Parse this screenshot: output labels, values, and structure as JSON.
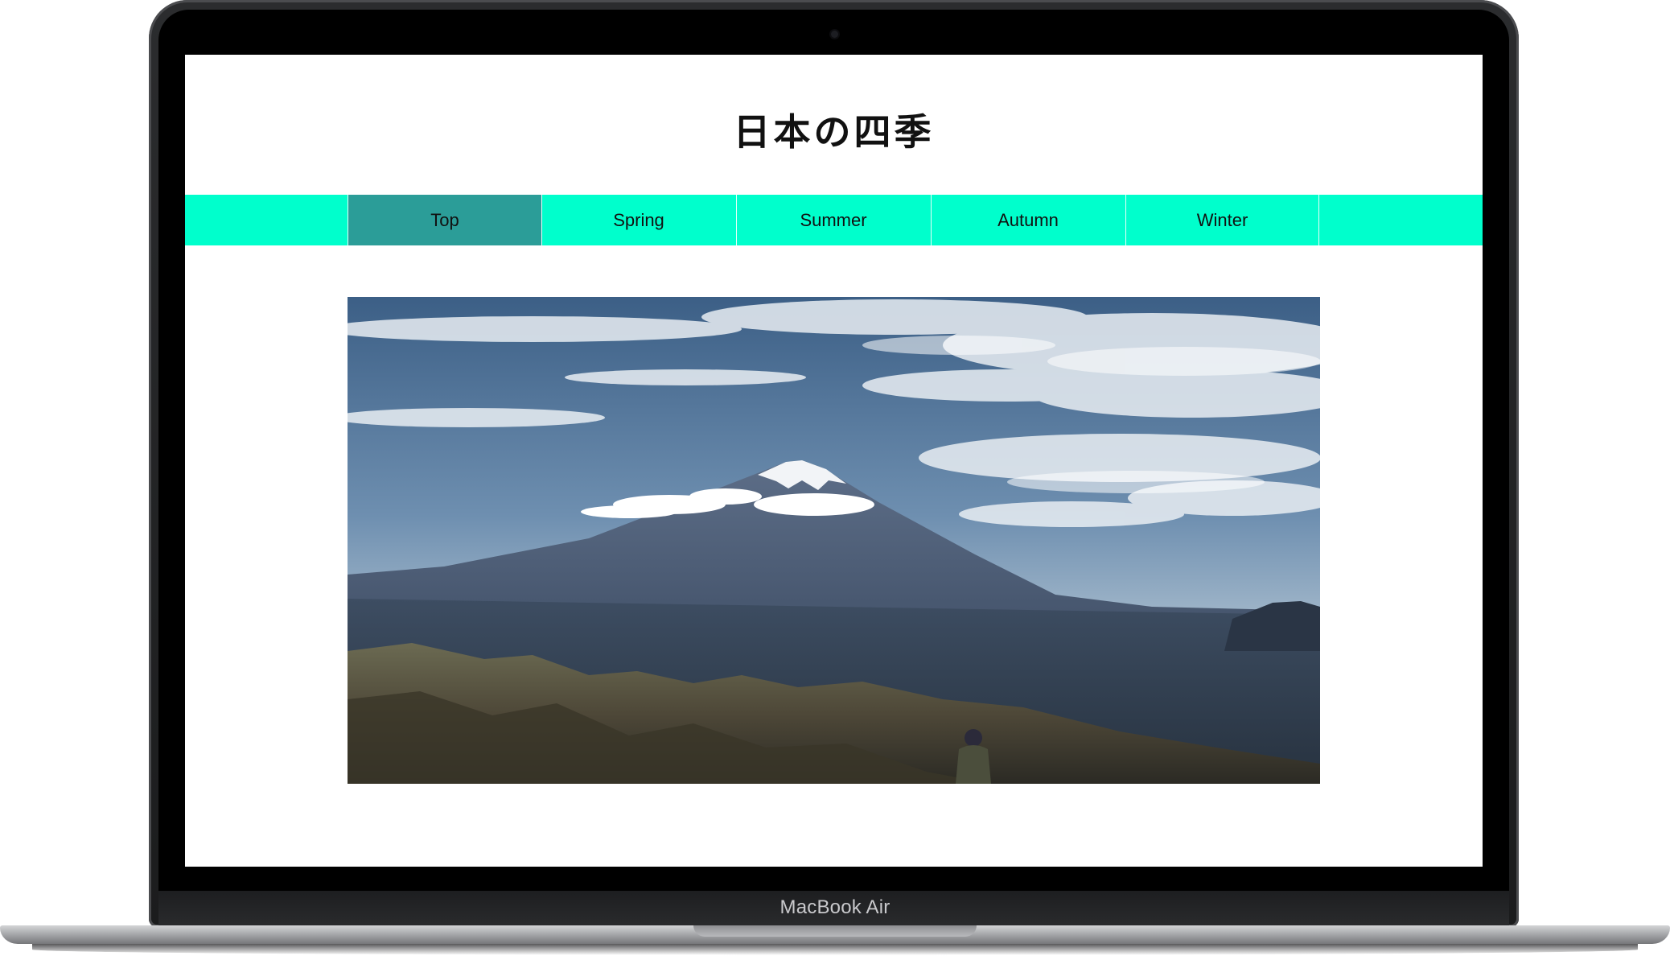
{
  "device": {
    "label": "MacBook Air"
  },
  "site": {
    "title": "日本の四季"
  },
  "nav": {
    "items": [
      {
        "label": "Top",
        "active": true
      },
      {
        "label": "Spring",
        "active": false
      },
      {
        "label": "Summer",
        "active": false
      },
      {
        "label": "Autumn",
        "active": false
      },
      {
        "label": "Winter",
        "active": false
      }
    ]
  },
  "colors": {
    "nav_background": "#00ffcc",
    "nav_active": "#2b9d98",
    "page_background": "#ffffff"
  },
  "hero": {
    "subject": "mount-fuji-landscape-photo"
  }
}
